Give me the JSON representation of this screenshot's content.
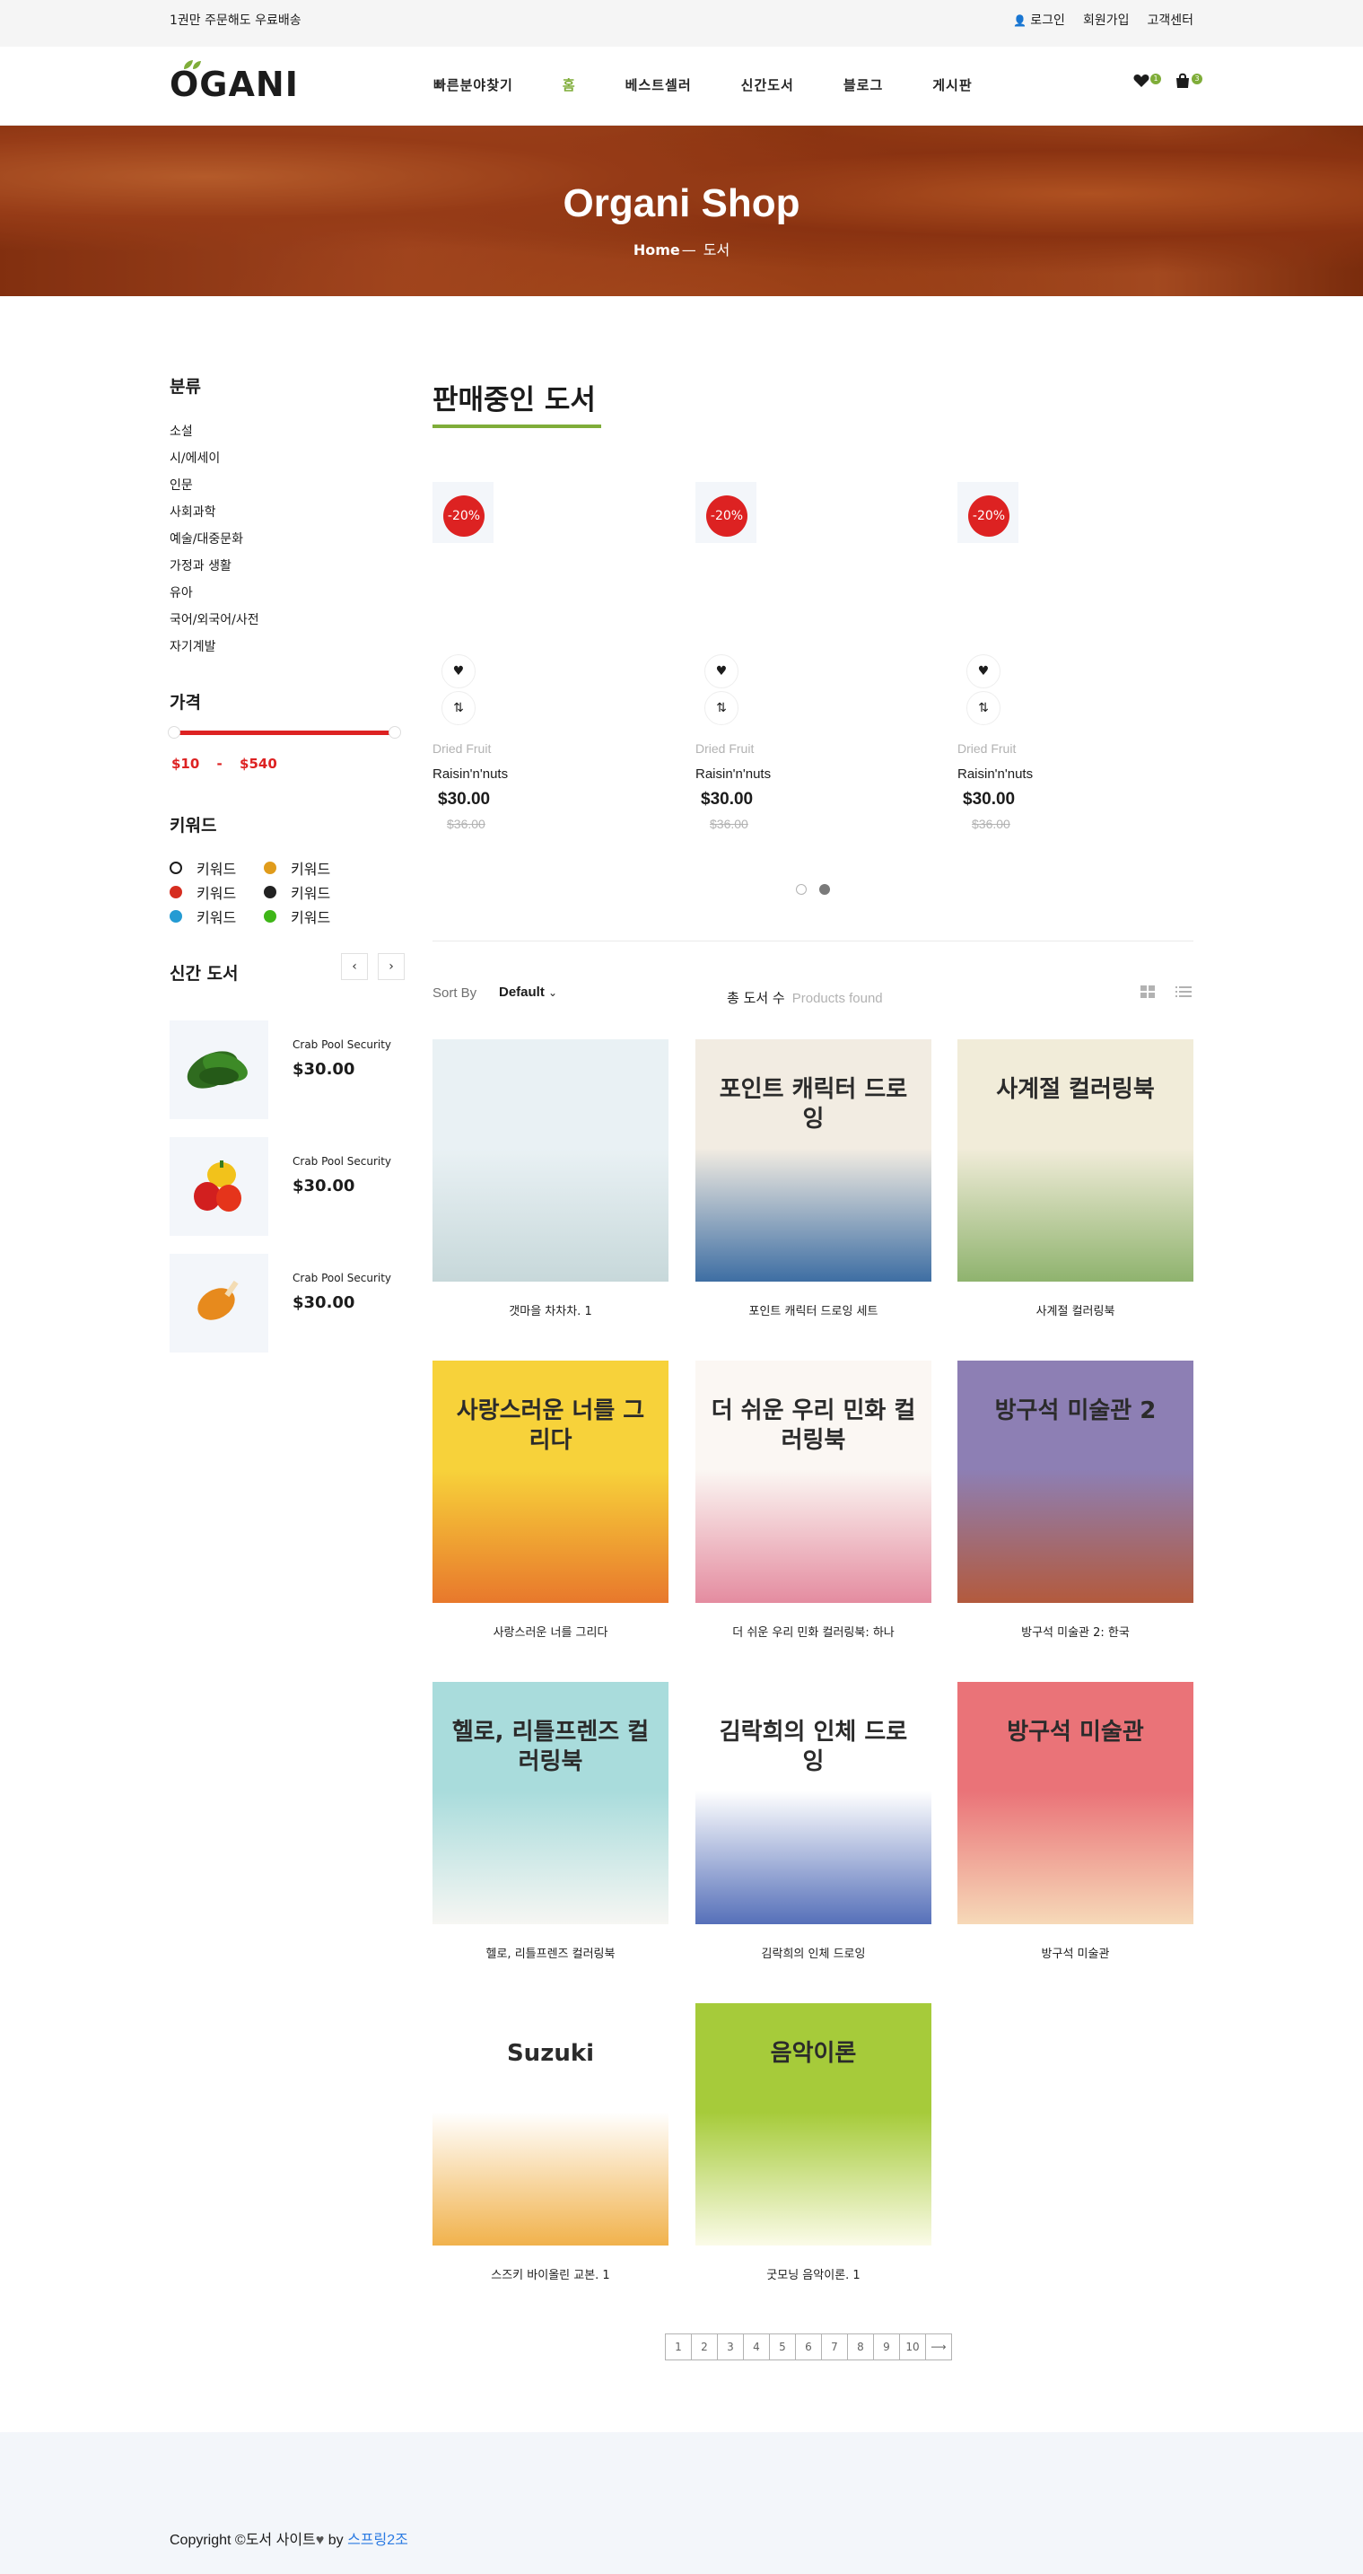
{
  "topbar": {
    "shipping_note": "1권만 주문해도 우료배송",
    "login": "로그인",
    "signup": "회원가입",
    "support": "고객센터"
  },
  "header": {
    "logo": "OGANI",
    "nav": [
      {
        "label": "빠른분야찾기",
        "active": false
      },
      {
        "label": "홈",
        "active": true
      },
      {
        "label": "베스트셀러",
        "active": false
      },
      {
        "label": "신간도서",
        "active": false
      },
      {
        "label": "블로그",
        "active": false
      },
      {
        "label": "게시판",
        "active": false
      }
    ],
    "wishlist_count": "1",
    "cart_count": "3"
  },
  "hero": {
    "title": "Organi Shop",
    "crumb_home": "Home",
    "crumb_sep": "—",
    "crumb_current": "도서"
  },
  "sidebar": {
    "categories_title": "분류",
    "categories": [
      "소설",
      "시/에세이",
      "인문",
      "사회과학",
      "예술/대중문화",
      "가정과 생활",
      "유아",
      "국어/외국어/사전",
      "자기계발"
    ],
    "price_title": "가격",
    "price_min": "$10",
    "price_sep": "-",
    "price_max": "$540",
    "keyword_title": "키워드",
    "keywords": [
      {
        "label": "키워드",
        "color": "#ffffff"
      },
      {
        "label": "키워드",
        "color": "#e09c1c"
      },
      {
        "label": "키워드",
        "color": "#d62d20"
      },
      {
        "label": "키워드",
        "color": "#222222"
      },
      {
        "label": "키워드",
        "color": "#249bd3"
      },
      {
        "label": "키워드",
        "color": "#3fb618"
      }
    ],
    "latest_title": "신간 도서",
    "latest": [
      {
        "name": "Crab Pool Security",
        "price": "$30.00",
        "icon": "spinach-icon"
      },
      {
        "name": "Crab Pool Security",
        "price": "$30.00",
        "icon": "peppers-icon"
      },
      {
        "name": "Crab Pool Security",
        "price": "$30.00",
        "icon": "chicken-icon"
      }
    ]
  },
  "sale": {
    "title": "판매중인 도서",
    "items": [
      {
        "discount": "-20%",
        "category": "Dried Fruit",
        "name": "Raisin'n'nuts",
        "price": "$30.00",
        "old_price": "$36.00"
      },
      {
        "discount": "-20%",
        "category": "Dried Fruit",
        "name": "Raisin'n'nuts",
        "price": "$30.00",
        "old_price": "$36.00"
      },
      {
        "discount": "-20%",
        "category": "Dried Fruit",
        "name": "Raisin'n'nuts",
        "price": "$30.00",
        "old_price": "$36.00"
      }
    ]
  },
  "filter": {
    "sort_label": "Sort By",
    "sort_value": "Default",
    "found_label": "총 도서 수",
    "found_suffix": "Products found"
  },
  "books": [
    {
      "title": "갯마을 차차차. 1",
      "cover_text": "",
      "cover_colors": [
        "#e9f1f4",
        "#c7d8da"
      ]
    },
    {
      "title": "포인트 캐릭터 드로잉 세트",
      "cover_text": "포인트 캐릭터 드로잉",
      "cover_colors": [
        "#f2ece2",
        "#3e6ea3"
      ]
    },
    {
      "title": "사계절 컬러링북",
      "cover_text": "사계절 컬러링북",
      "cover_colors": [
        "#f1ecd9",
        "#8fb36e"
      ]
    },
    {
      "title": "사랑스러운 너를 그리다",
      "cover_text": "사랑스러운 너를 그리다",
      "cover_colors": [
        "#f7d23a",
        "#e8782c"
      ]
    },
    {
      "title": "더 쉬운 우리 민화 컬러링북: 하나",
      "cover_text": "더 쉬운 우리 민화 컬러링북",
      "cover_colors": [
        "#fbf7f3",
        "#e48ca0"
      ]
    },
    {
      "title": "방구석 미술관 2: 한국",
      "cover_text": "방구석 미술관 2",
      "cover_colors": [
        "#8d7fb4",
        "#b35a3d"
      ]
    },
    {
      "title": "헬로, 리틀프렌즈 컬러링북",
      "cover_text": "헬로, 리틀프렌즈 컬러링북",
      "cover_colors": [
        "#a9dcdc",
        "#f6f6f3"
      ]
    },
    {
      "title": "김락희의 인체 드로잉",
      "cover_text": "김락희의 인체 드로잉",
      "cover_colors": [
        "#ffffff",
        "#5670b9"
      ]
    },
    {
      "title": "방구석 미술관",
      "cover_text": "방구석 미술관",
      "cover_colors": [
        "#ea7378",
        "#f6d9b8"
      ]
    },
    {
      "title": "스즈키 바이올린 교본. 1",
      "cover_text": "Suzuki",
      "cover_colors": [
        "#ffffff",
        "#f1b24c"
      ]
    },
    {
      "title": "굿모닝 음악이론. 1",
      "cover_text": "음악이론",
      "cover_colors": [
        "#a6cb3a",
        "#fbfbe8"
      ]
    }
  ],
  "pagination": [
    "1",
    "2",
    "3",
    "4",
    "5",
    "6",
    "7",
    "8",
    "9",
    "10",
    "⟶"
  ],
  "footer": {
    "copyright": "Copyright ©도서 사이트",
    "by": "by",
    "author": "스프링2조"
  }
}
